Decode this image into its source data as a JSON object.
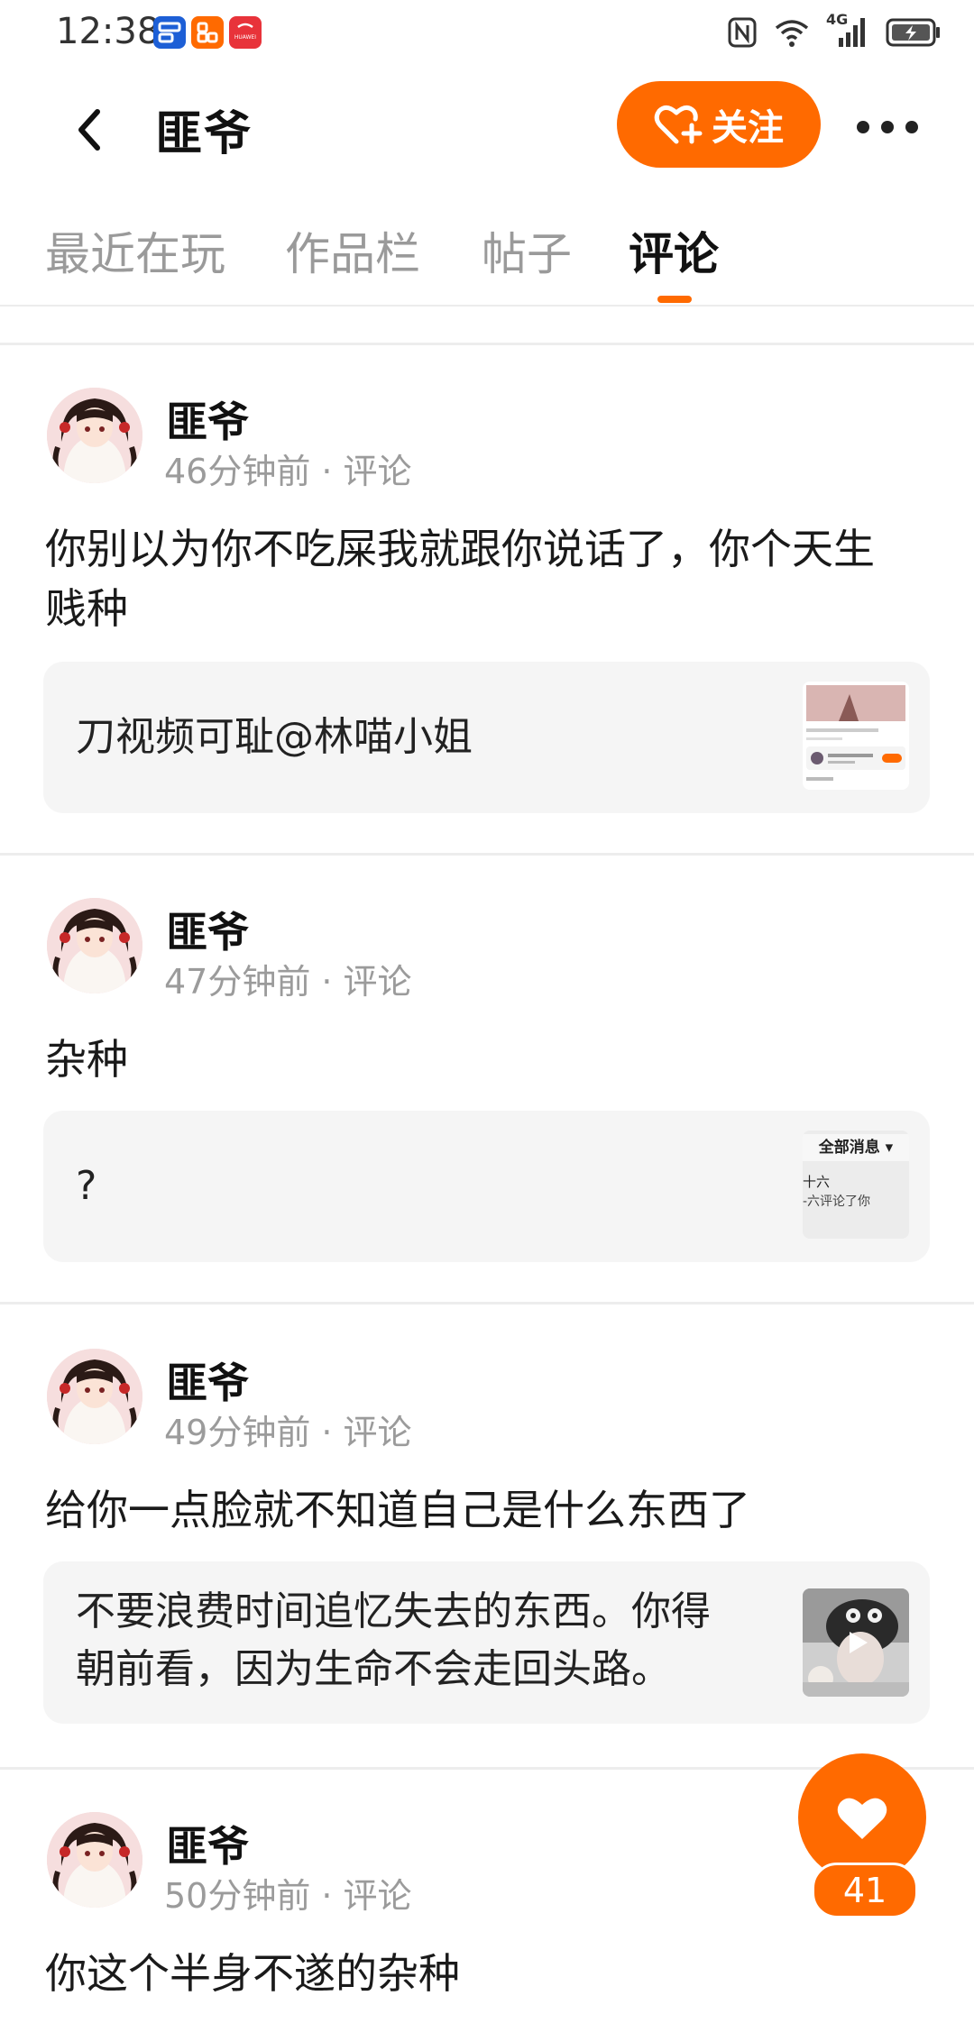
{
  "status_bar": {
    "time": "12:38",
    "app_icons": [
      {
        "name": "app-icon-blue",
        "color": "#1d5fd6"
      },
      {
        "name": "app-icon-orange",
        "color": "#ff6a00"
      },
      {
        "name": "app-icon-huawei",
        "label": "HUAWEI",
        "color": "#e8333a"
      }
    ],
    "network_label": "4G",
    "icons": [
      "nfc-icon",
      "wifi-icon",
      "cellular-signal-icon",
      "battery-charging-icon"
    ]
  },
  "header": {
    "title": "匪爷",
    "follow_label": "关注",
    "icons": [
      "back-arrow-icon",
      "heart-plus-icon",
      "more-icon"
    ]
  },
  "tabs": [
    {
      "label": "最近在玩",
      "active": false
    },
    {
      "label": "作品栏",
      "active": false
    },
    {
      "label": "帖子",
      "active": false
    },
    {
      "label": "评论",
      "active": true
    }
  ],
  "posts": [
    {
      "author": "匪爷",
      "time": "46分钟前",
      "separator": "·",
      "type": "评论",
      "text_lines": [
        "你别以为你不吃屎我就跟你说话了，你个天生",
        "贱种"
      ],
      "quote_lines": [
        "刀视频可耻@林喵小姐"
      ],
      "thumb": "screenshot"
    },
    {
      "author": "匪爷",
      "time": "47分钟前",
      "separator": "·",
      "type": "评论",
      "text_lines": [
        "杂种"
      ],
      "quote_lines": [
        "?"
      ],
      "thumb": "message",
      "thumb_text": {
        "header": "全部消息 ▾",
        "line1": "十六",
        "line2": "-六评论了你"
      }
    },
    {
      "author": "匪爷",
      "time": "49分钟前",
      "separator": "·",
      "type": "评论",
      "text_lines": [
        "给你一点脸就不知道自己是什么东西了"
      ],
      "quote_lines": [
        "不要浪费时间追忆失去的东西。你得",
        "朝前看，因为生命不会走回头路。"
      ],
      "thumb": "video"
    },
    {
      "author": "匪爷",
      "time": "50分钟前",
      "separator": "·",
      "type": "评论",
      "text_lines": [
        "你这个半身不遂的杂种"
      ]
    }
  ],
  "like": {
    "count": "41",
    "icon": "heart-icon"
  },
  "colors": {
    "accent": "#ff6a00",
    "muted": "#9b9b9b",
    "card_bg": "#f5f5f5"
  }
}
